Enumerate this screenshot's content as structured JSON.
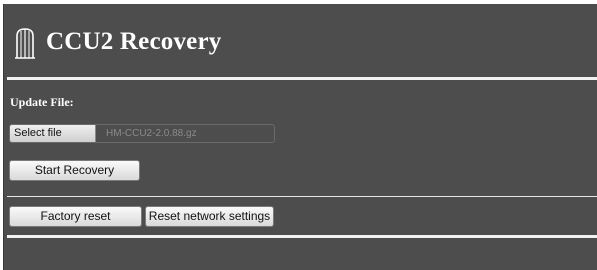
{
  "header": {
    "title": "CCU2 Recovery",
    "logo_icon": "building-logo-icon"
  },
  "form": {
    "update_label": "Update File:",
    "file_button_label": "Select file",
    "file_name": "HM-CCU2-2.0.88.gz"
  },
  "buttons": {
    "start_recovery": "Start Recovery",
    "factory_reset": "Factory reset",
    "reset_network": "Reset network settings"
  },
  "colors": {
    "panel_background": "#4d4d4d",
    "title_text": "#ffffff",
    "separator": "#f2f2f2"
  }
}
